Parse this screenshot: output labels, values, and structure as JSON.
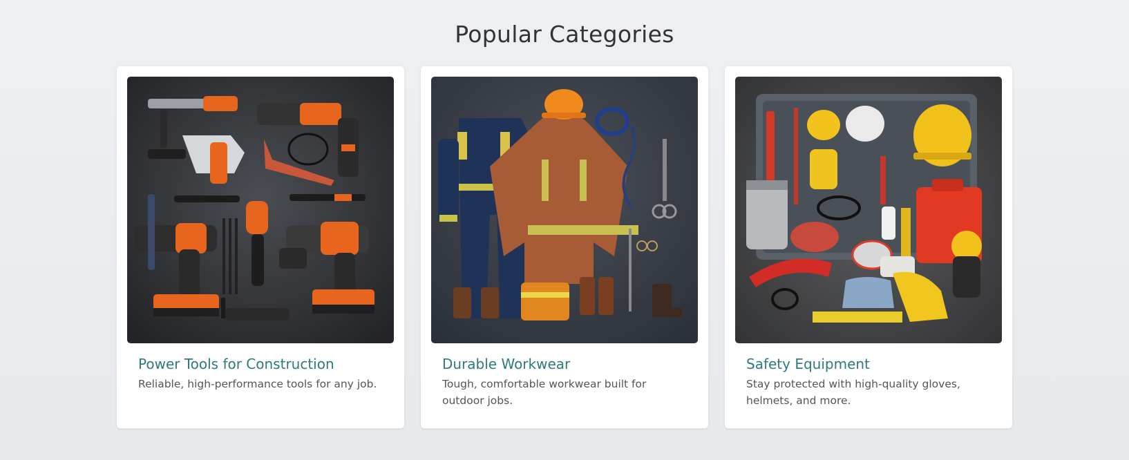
{
  "section": {
    "title": "Popular Categories"
  },
  "cards": [
    {
      "title": "Power Tools for Construction",
      "description": "Reliable, high-performance tools for any job.",
      "image": "power-tools-flatlay"
    },
    {
      "title": "Durable Workwear",
      "description": "Tough, comfortable workwear built for outdoor jobs.",
      "image": "workwear-flatlay"
    },
    {
      "title": "Safety Equipment",
      "description": "Stay protected with high-quality gloves, helmets, and more.",
      "image": "safety-gear-flatlay"
    }
  ],
  "colors": {
    "background": "#eceff2",
    "card": "#ffffff",
    "title": "#2c7a80",
    "heading": "#333333",
    "text": "#555555"
  }
}
